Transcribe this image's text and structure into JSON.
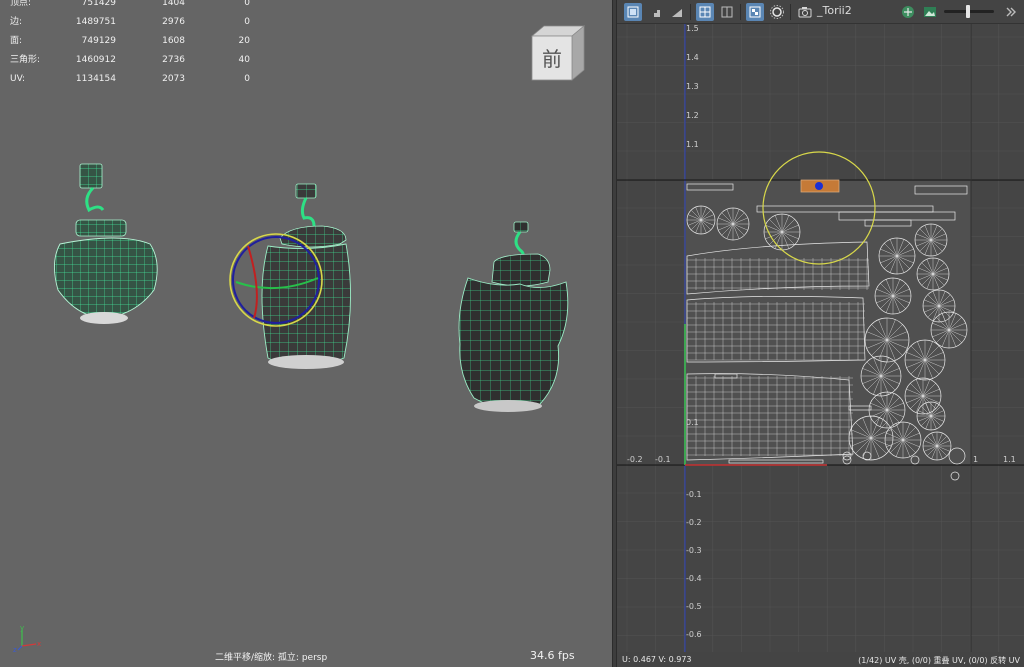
{
  "viewport": {
    "hud": [
      {
        "label": "顶点:",
        "v1": "751429",
        "v2": "1404",
        "v3": "0"
      },
      {
        "label": "边:",
        "v1": "1489751",
        "v2": "2976",
        "v3": "0"
      },
      {
        "label": "面:",
        "v1": "749129",
        "v2": "1608",
        "v3": "20"
      },
      {
        "label": "三角形:",
        "v1": "1460912",
        "v2": "2736",
        "v3": "40"
      },
      {
        "label": "UV:",
        "v1": "1134154",
        "v2": "2073",
        "v3": "0"
      }
    ],
    "view_cube_label": "前",
    "footer_text": "二维平移/缩放: 孤立: persp",
    "fps": "34.6 fps",
    "axis_labels": {
      "y": "y",
      "x": "x",
      "z": "z"
    }
  },
  "uv_editor": {
    "camera_name": "_Torii2",
    "axis_labels_y": [
      "1.5",
      "1.4",
      "1.3",
      "1.2",
      "1.1",
      "0.1",
      "-0.1",
      "-0.2",
      "-0.3",
      "-0.4",
      "-0.5",
      "-0.6"
    ],
    "axis_labels_x": [
      "-0.2",
      "-0.1",
      "1",
      "1.1"
    ],
    "status_left": "U:  0.467  V:  0.973",
    "status_right": "(1/42) UV 壳, (0/0) 重叠 UV, (0/0) 反转 UV"
  },
  "colors": {
    "viewport_bg": "#656565",
    "uv_bg": "#454545",
    "wire_green": "#2fe08a",
    "active_blue": "#5a86b4",
    "manip_yellow": "#d8d84a"
  }
}
